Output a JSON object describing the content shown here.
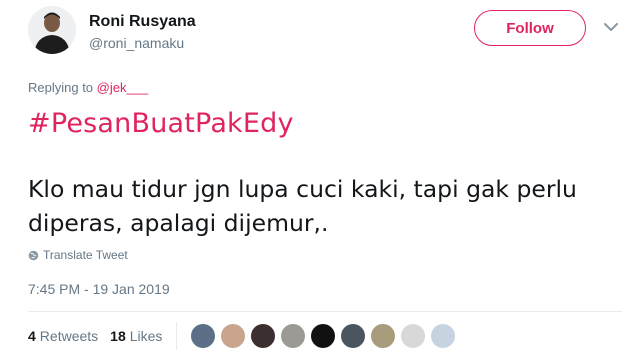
{
  "author": {
    "name": "Roni Rusyana",
    "handle": "@roni_namaku"
  },
  "follow": {
    "label": "Follow"
  },
  "reply": {
    "prefix": "Replying to",
    "mention": "@jek___"
  },
  "tweet": {
    "hashtag": "#PesanBuatPakEdy",
    "text": "Klo mau tidur jgn lupa cuci kaki, tapi gak perlu diperas, apalagi dijemur,."
  },
  "translate": {
    "label": "Translate Tweet"
  },
  "timestamp": "7:45 PM - 19 Jan 2019",
  "stats": {
    "retweets_count": "4",
    "retweets_label": "Retweets",
    "likes_count": "18",
    "likes_label": "Likes"
  },
  "colors": {
    "accent": "#e0245e",
    "muted": "#657786",
    "text": "#14171a",
    "divider": "#e6ecf0"
  },
  "likers": [
    {
      "name": "liker-avatar-1",
      "color": "#5b6f86"
    },
    {
      "name": "liker-avatar-2",
      "color": "#c9a58e"
    },
    {
      "name": "liker-avatar-3",
      "color": "#3b2f2f"
    },
    {
      "name": "liker-avatar-4",
      "color": "#9c9a94"
    },
    {
      "name": "liker-avatar-5",
      "color": "#111111"
    },
    {
      "name": "liker-avatar-6",
      "color": "#4a5560"
    },
    {
      "name": "liker-avatar-7",
      "color": "#a89c7c"
    },
    {
      "name": "liker-avatar-8",
      "color": "#d8d8d8"
    },
    {
      "name": "liker-avatar-9",
      "color": "#c7d3e0"
    }
  ]
}
